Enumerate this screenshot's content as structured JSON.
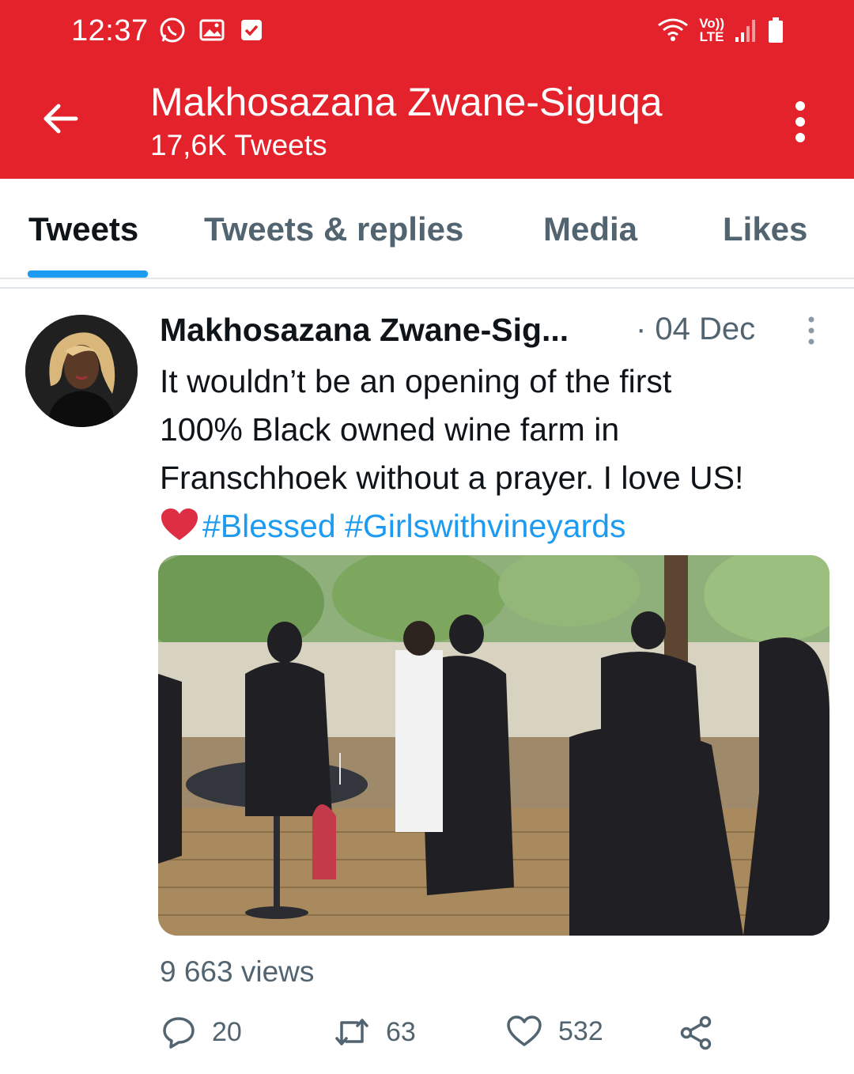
{
  "status_bar": {
    "time": "12:37",
    "network_label_top": "Vo))",
    "network_label_bottom": "LTE",
    "icons": [
      "whatsapp-icon",
      "gallery-icon",
      "checkbox-icon",
      "wifi-icon",
      "signal-icon",
      "battery-icon"
    ]
  },
  "header": {
    "title": "Makhosazana Zwane-Siguqa",
    "subtitle": "17,6K Tweets",
    "color": "#e3222b"
  },
  "tabs": [
    {
      "label": "Tweets",
      "active": true
    },
    {
      "label": "Tweets & replies",
      "active": false
    },
    {
      "label": "Media",
      "active": false
    },
    {
      "label": "Likes",
      "active": false
    }
  ],
  "tweet": {
    "author": "Makhosazana Zwane-Sig...",
    "date": "· 04 Dec",
    "text_lines": [
      "It wouldn’t be an opening of the first",
      "100% Black owned wine farm in",
      "Franschhoek without a prayer. I love US!"
    ],
    "hashtags": [
      "#Blessed",
      "#Girlswithvineyards"
    ],
    "views": "9 663 views",
    "replies": "20",
    "retweets": "63",
    "likes": "532"
  },
  "colors": {
    "accent": "#1d9bf0",
    "brand_header": "#e3222b",
    "secondary_text": "#536471"
  }
}
